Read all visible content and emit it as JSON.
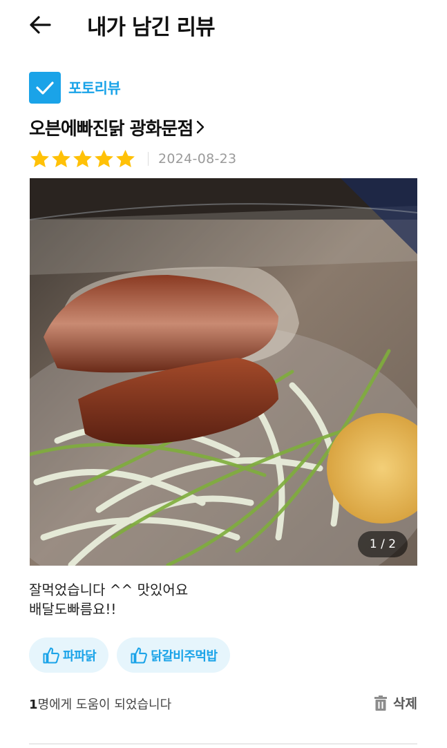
{
  "header": {
    "back_icon": "arrow-left-icon",
    "title": "내가 남긴 리뷰"
  },
  "review": {
    "badge": {
      "icon": "check-icon",
      "label": "포토리뷰",
      "color": "#1aa3e8"
    },
    "store_name": "오븐에빠진닭 광화문점",
    "rating": 5,
    "rating_max": 5,
    "star_color": "#ffc107",
    "date": "2024-08-23",
    "photo": {
      "description_icon": "food-photo",
      "counter": "1 / 2"
    },
    "text": "잘먹었습니다 ^^ 맛있어요\n배달도빠름요!!",
    "liked_menus": [
      {
        "icon": "thumbs-up-icon",
        "label": "파파닭"
      },
      {
        "icon": "thumbs-up-icon",
        "label": "닭갈비주먹밥"
      }
    ],
    "helpful": {
      "count": "1",
      "suffix": "명에게 도움이 되었습니다"
    },
    "delete": {
      "icon": "trash-icon",
      "label": "삭제"
    }
  }
}
